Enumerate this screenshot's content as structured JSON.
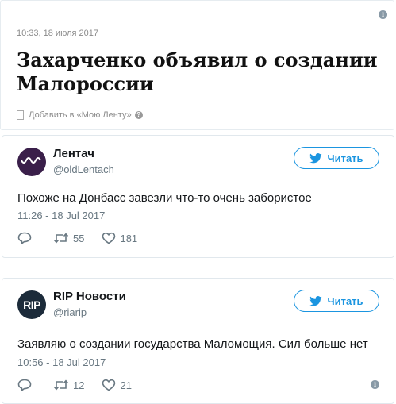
{
  "article": {
    "timestamp": "10:33, 18 июля 2017",
    "headline": "Захарченко объявил о создании Малороссии",
    "add_to_feed": "Добавить в «Мою Ленту»"
  },
  "tweets": [
    {
      "name": "Лентач",
      "handle": "@oldLentach",
      "follow_label": "Читать",
      "text": "Похоже на Донбасс завезли что-то очень забористое",
      "time": "11:26 - 18 Jul 2017",
      "retweets": "55",
      "likes": "181",
      "replies": ""
    },
    {
      "name": "RIP Новости",
      "handle": "@riarip",
      "avatar_text": "RIP",
      "follow_label": "Читать",
      "text": "Заявляю о создании государства Маломощия. Сил больше нет",
      "time": "10:56 - 18 Jul 2017",
      "retweets": "12",
      "likes": "21",
      "replies": ""
    }
  ],
  "colors": {
    "accent": "#1b95e0",
    "muted": "#697882",
    "border": "#e1e8ed"
  }
}
